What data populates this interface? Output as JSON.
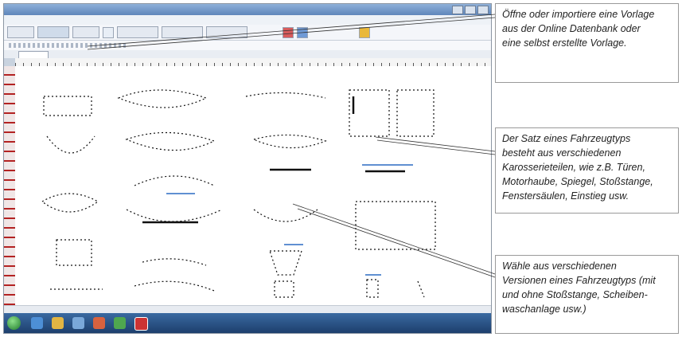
{
  "screenshot": {
    "toolbar": {
      "buttons": [
        "",
        "",
        "",
        "",
        "",
        "",
        ""
      ]
    },
    "accent_colors": {
      "taskbar": "#1d3f6d",
      "ruler": "#b32222",
      "highlight": "#2b6cc4"
    }
  },
  "callouts": [
    {
      "text": "Öffne oder importiere eine Vorlage\naus der Online Datenbank oder\neine selbst erstellte Vorlage."
    },
    {
      "text": "Der Satz eines Fahrzeugtyps\nbesteht aus verschiedenen\nKarosserieteilen, wie z.B. Türen,\nMotorhaube, Spiegel, Stoßstange,\nFenstersäulen, Einstieg usw."
    },
    {
      "text": "Wähle aus verschiedenen\nVersionen eines Fahrzeugtyps (mit\nund ohne Stoßstange, Scheiben-\nwaschanlage usw.)"
    }
  ]
}
